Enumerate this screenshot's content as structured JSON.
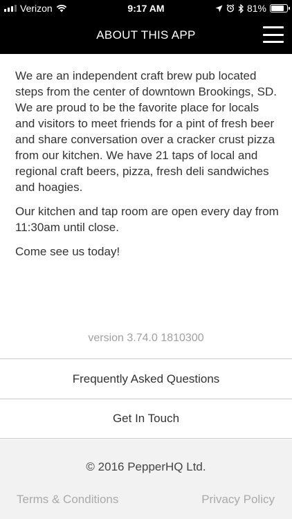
{
  "status_bar": {
    "carrier": "Verizon",
    "time": "9:17 AM",
    "battery_percent": "81%",
    "battery_level": 0.81
  },
  "nav": {
    "title": "ABOUT THIS APP",
    "menu_icon": "hamburger-menu-icon"
  },
  "about": {
    "paragraphs": [
      "We are an independent craft brew pub located steps from the center of downtown Brookings, SD. We are proud to be the favorite place for locals and visitors to meet friends for a pint of fresh beer and share conversation over a cracker crust pizza from our kitchen. We have 21 taps of local and regional craft beers, pizza, fresh deli sandwiches and hoagies.",
      "Our kitchen and tap room are open every day from 11:30am until close.",
      "Come see us today!"
    ]
  },
  "version": "version 3.74.0 1810300",
  "links": {
    "faq": "Frequently Asked Questions",
    "contact": "Get In Touch"
  },
  "footer": {
    "copyright": "© 2016 PepperHQ Ltd.",
    "terms": "Terms & Conditions",
    "privacy": "Privacy Policy"
  }
}
